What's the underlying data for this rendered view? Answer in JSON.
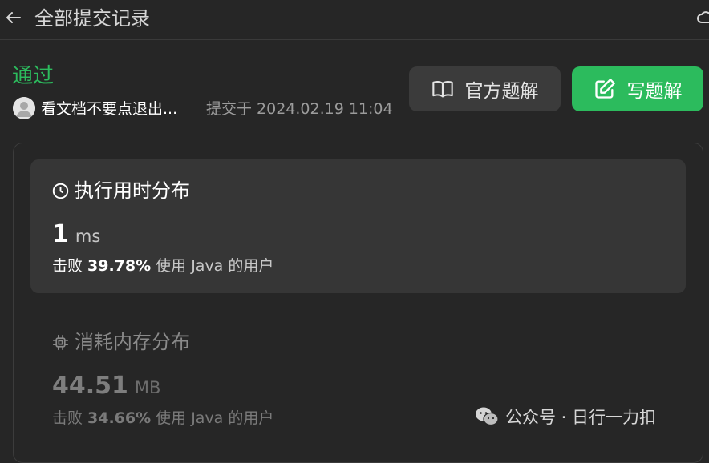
{
  "header": {
    "title": "全部提交记录"
  },
  "submission": {
    "status": "通过",
    "username": "看文档不要点退出...",
    "submitted_label": "提交于",
    "submitted_time": "2024.02.19 11:04"
  },
  "actions": {
    "official_solution_label": "官方题解",
    "write_solution_label": "写题解"
  },
  "runtime": {
    "title": "执行用时分布",
    "value": "1",
    "unit": "ms",
    "beat_prefix": "击败",
    "beat_percent": "39.78%",
    "beat_suffix": "使用 Java 的用户"
  },
  "memory": {
    "title": "消耗内存分布",
    "value": "44.51",
    "unit": "MB",
    "beat_prefix": "击败",
    "beat_percent": "34.66%",
    "beat_suffix": "使用 Java 的用户"
  },
  "watermark": {
    "text": "公众号 · 日行一力扣"
  },
  "colors": {
    "background": "#262626",
    "accent_green": "#2cbb5d",
    "card_bg": "#363636"
  }
}
